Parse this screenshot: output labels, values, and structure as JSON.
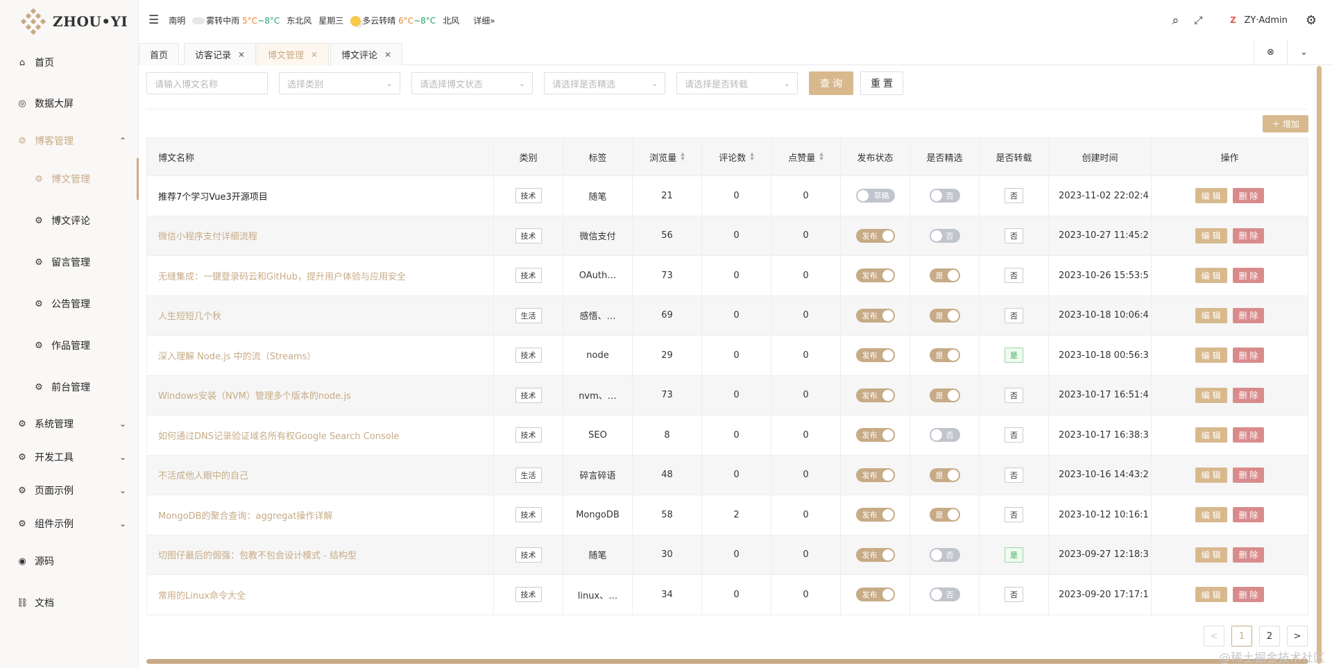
{
  "app": {
    "logo_text": "ZHOU•YI"
  },
  "sidebar": {
    "items": [
      {
        "label": "首页"
      },
      {
        "label": "数据大屏"
      },
      {
        "label": "博客管理"
      },
      {
        "label": "博文管理"
      },
      {
        "label": "博文评论"
      },
      {
        "label": "留言管理"
      },
      {
        "label": "公告管理"
      },
      {
        "label": "作品管理"
      },
      {
        "label": "前台管理"
      },
      {
        "label": "系统管理"
      },
      {
        "label": "开发工具"
      },
      {
        "label": "页面示例"
      },
      {
        "label": "组件示例"
      },
      {
        "label": "源码"
      },
      {
        "label": "文档"
      }
    ]
  },
  "header": {
    "city": "南明",
    "today_weather": "雾转中雨",
    "today_low": "5°C",
    "today_sep": "~",
    "today_high": "8°C",
    "today_wind": "东北风",
    "weekday": "星期三",
    "next_weather": "多云转晴",
    "next_low": "6°C",
    "next_sep": "~",
    "next_high": "8°C",
    "next_wind": "北风",
    "detail_link": "详细»",
    "username": "ZY·Admin",
    "avatar_letter": "Z"
  },
  "tabs": [
    {
      "label": "首页"
    },
    {
      "label": "访客记录"
    },
    {
      "label": "博文管理"
    },
    {
      "label": "博文评论"
    }
  ],
  "filters": {
    "title_placeholder": "请输入博文名称",
    "category_placeholder": "选择类别",
    "status_placeholder": "请选择博文状态",
    "featured_placeholder": "请选择是否精选",
    "repost_placeholder": "请选择是否转载",
    "query_label": "查询",
    "reset_label": "重置"
  },
  "add_button_label": "＋ 增加",
  "table": {
    "columns": [
      "博文名称",
      "类别",
      "标签",
      "浏览量",
      "评论数",
      "点赞量",
      "发布状态",
      "是否精选",
      "是否转载",
      "创建时间",
      "操作"
    ],
    "switch_on_publish": "发布",
    "switch_off_publish": "草稿",
    "switch_on_featured": "是",
    "switch_off_featured": "否",
    "edit_label": "编 辑",
    "delete_label": "删 除",
    "rows": [
      {
        "title": "推荐7个学习Vue3开源项目",
        "category": "技术",
        "tag": "随笔",
        "views": "21",
        "comments": "0",
        "likes": "0",
        "published": false,
        "featured": false,
        "repost": "否",
        "created": "2023-11-02 22:02:4"
      },
      {
        "title": "微信小程序支付详细流程",
        "category": "技术",
        "tag": "微信支付",
        "views": "56",
        "comments": "0",
        "likes": "0",
        "published": true,
        "featured": false,
        "repost": "否",
        "created": "2023-10-27 11:45:2"
      },
      {
        "title": "无缝集成：一键登录码云和GitHub，提升用户体验与应用安全",
        "category": "技术",
        "tag": "OAuth…",
        "views": "73",
        "comments": "0",
        "likes": "0",
        "published": true,
        "featured": true,
        "repost": "否",
        "created": "2023-10-26 15:53:5"
      },
      {
        "title": "人生短短几个秋",
        "category": "生活",
        "tag": "感悟、…",
        "views": "69",
        "comments": "0",
        "likes": "0",
        "published": true,
        "featured": true,
        "repost": "否",
        "created": "2023-10-18 10:06:4"
      },
      {
        "title": "深入理解 Node.js 中的流（Streams）",
        "category": "技术",
        "tag": "node",
        "views": "29",
        "comments": "0",
        "likes": "0",
        "published": true,
        "featured": true,
        "repost": "是",
        "created": "2023-10-18 00:56:3"
      },
      {
        "title": "Windows安装（NVM）管理多个版本的node.js",
        "category": "技术",
        "tag": "nvm、…",
        "views": "73",
        "comments": "0",
        "likes": "0",
        "published": true,
        "featured": true,
        "repost": "否",
        "created": "2023-10-17 16:51:4"
      },
      {
        "title": "如何通过DNS记录验证域名所有权Google Search Console",
        "category": "技术",
        "tag": "SEO",
        "views": "8",
        "comments": "0",
        "likes": "0",
        "published": true,
        "featured": false,
        "repost": "否",
        "created": "2023-10-17 16:38:3"
      },
      {
        "title": "不活成他人眼中的自己",
        "category": "生活",
        "tag": "碎言碎语",
        "views": "48",
        "comments": "0",
        "likes": "0",
        "published": true,
        "featured": true,
        "repost": "否",
        "created": "2023-10-16 14:43:2"
      },
      {
        "title": "MongoDB的聚合查询：aggregat操作详解",
        "category": "技术",
        "tag": "MongoDB",
        "views": "58",
        "comments": "2",
        "likes": "0",
        "published": true,
        "featured": true,
        "repost": "否",
        "created": "2023-10-12 10:16:1"
      },
      {
        "title": "切图仔最后的倔强：包教不包会设计模式 - 结构型",
        "category": "技术",
        "tag": "随笔",
        "views": "30",
        "comments": "0",
        "likes": "0",
        "published": true,
        "featured": false,
        "repost": "是",
        "created": "2023-09-27 12:18:3"
      },
      {
        "title": "常用的Linux命令大全",
        "category": "技术",
        "tag": "linux、…",
        "views": "34",
        "comments": "0",
        "likes": "0",
        "published": true,
        "featured": false,
        "repost": "否",
        "created": "2023-09-20 17:17:1"
      }
    ]
  },
  "pagination": {
    "prev": "<",
    "pages": [
      "1",
      "2"
    ],
    "current": "1",
    "next": ">"
  },
  "watermark": "@稀土掘金技术社区",
  "colors": {
    "accent": "#c7ab86",
    "button": "#d8b98e",
    "danger": "#d98b8b",
    "switch_off": "#c0c4cc"
  }
}
